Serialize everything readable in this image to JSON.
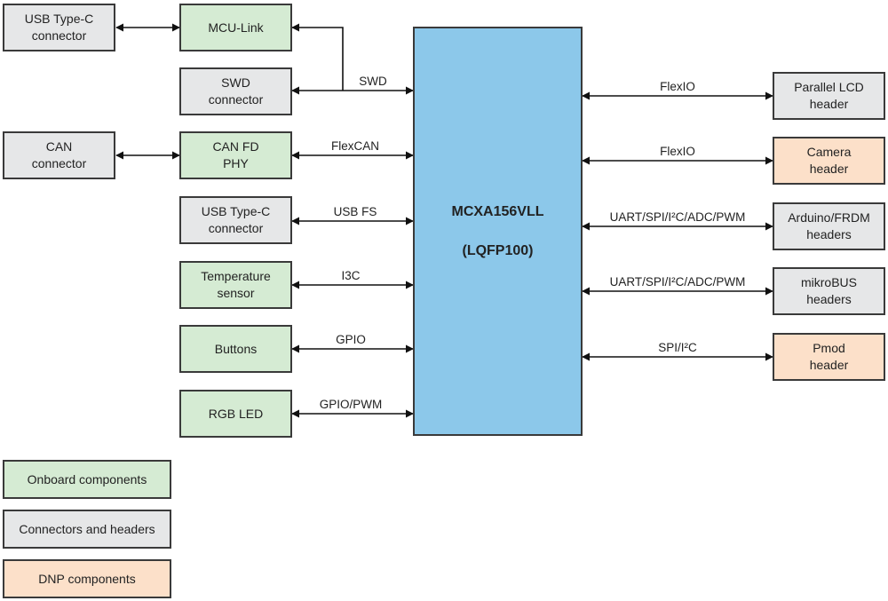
{
  "mcu": {
    "line1": "MCXA156VLL",
    "line2": "(LQFP100)"
  },
  "colors": {
    "onboard": "#d5ebd3",
    "connector": "#e6e7e8",
    "dnp": "#fce0c9",
    "mcu": "#8cc8ea"
  },
  "left_outer": [
    {
      "id": "usb-typec-connector-debug",
      "text": "USB Type-C\nconnector",
      "category": "connector"
    },
    {
      "id": "can-connector",
      "text": "CAN\nconnector",
      "category": "connector"
    }
  ],
  "left_blocks": [
    {
      "id": "mcu-link",
      "text": "MCU-Link",
      "category": "onboard"
    },
    {
      "id": "swd-connector",
      "text": "SWD\nconnector",
      "category": "connector"
    },
    {
      "id": "can-fd-phy",
      "text": "CAN FD\nPHY",
      "category": "onboard"
    },
    {
      "id": "usb-typec-connector",
      "text": "USB Type-C\nconnector",
      "category": "connector"
    },
    {
      "id": "temperature-sensor",
      "text": "Temperature\nsensor",
      "category": "onboard"
    },
    {
      "id": "buttons",
      "text": "Buttons",
      "category": "onboard"
    },
    {
      "id": "rgb-led",
      "text": "RGB LED",
      "category": "onboard"
    }
  ],
  "left_links": [
    "SWD",
    "FlexCAN",
    "USB FS",
    "I3C",
    "GPIO",
    "GPIO/PWM"
  ],
  "right_blocks": [
    {
      "id": "parallel-lcd-header",
      "text": "Parallel LCD\nheader",
      "category": "connector",
      "link": "FlexIO"
    },
    {
      "id": "camera-header",
      "text": "Camera\nheader",
      "category": "dnp",
      "link": "FlexIO"
    },
    {
      "id": "arduino-frdm-headers",
      "text": "Arduino/FRDM\nheaders",
      "category": "connector",
      "link": "UART/SPI/I²C/ADC/PWM"
    },
    {
      "id": "mikrobus-headers",
      "text": "mikroBUS\nheaders",
      "category": "connector",
      "link": "UART/SPI/I²C/ADC/PWM"
    },
    {
      "id": "pmod-header",
      "text": "Pmod\nheader",
      "category": "dnp",
      "link": "SPI/I²C"
    }
  ],
  "legend": [
    {
      "text": "Onboard components",
      "category": "onboard"
    },
    {
      "text": "Connectors and headers",
      "category": "connector"
    },
    {
      "text": "DNP components",
      "category": "dnp"
    }
  ]
}
